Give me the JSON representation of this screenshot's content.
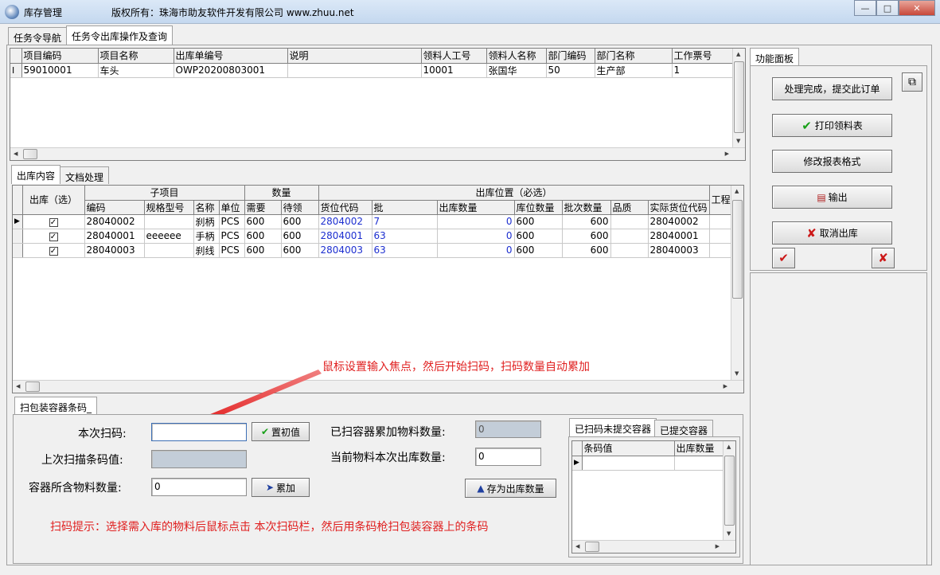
{
  "window": {
    "title": "库存管理",
    "copyright": "版权所有：珠海市助友软件开发有限公司 www.zhuu.net",
    "btn_min": "—",
    "btn_max": "□",
    "btn_close": "✕"
  },
  "top_tabs": [
    {
      "label": "任务令导航"
    },
    {
      "label": "任务令出库操作及查询"
    }
  ],
  "order_grid": {
    "row_indicator": "I",
    "columns": [
      "项目编码",
      "项目名称",
      "出库单编号",
      "说明",
      "领料人工号",
      "领料人名称",
      "部门编码",
      "部门名称",
      "工作票号"
    ],
    "rows": [
      [
        "59010001",
        "车头",
        "OWP20200803001",
        "",
        "10001",
        "张国华",
        "50",
        "生产部",
        "1"
      ]
    ]
  },
  "function_panel": {
    "tab": "功能面板",
    "submit": "处理完成，提交此订单",
    "print": "打印领料表",
    "modify_format": "修改报表格式",
    "export": "输出",
    "cancel": "取消出库"
  },
  "content_tabs": [
    {
      "label": "出库内容"
    },
    {
      "label": "文档处理"
    }
  ],
  "items_grid": {
    "group_headers": {
      "out": "出库（选）",
      "sub_item": "子项目",
      "qty": "数量",
      "location": "出库位置（必选）",
      "project": "工程"
    },
    "columns": {
      "code": "编码",
      "spec": "规格型号",
      "name": "名称",
      "unit": "单位",
      "need": "需要",
      "pending": "待领",
      "loc_code": "货位代码",
      "batch": "批",
      "out_qty": "出库数量",
      "loc_qty": "库位数量",
      "batch_qty": "批次数量",
      "quality": "品质",
      "actual_loc": "实际货位代码"
    },
    "rows": [
      {
        "checked": true,
        "code": "28040002",
        "spec": "",
        "name": "刹柄",
        "unit": "PCS",
        "need": "600",
        "pending": "600",
        "loc_code": "2804002",
        "batch": "7",
        "out_qty": "0",
        "loc_qty": "600",
        "batch_qty": "600",
        "quality": "",
        "actual_loc": "28040002"
      },
      {
        "checked": true,
        "code": "28040001",
        "spec": "eeeeee",
        "name": "手柄",
        "unit": "PCS",
        "need": "600",
        "pending": "600",
        "loc_code": "2804001",
        "batch": "63",
        "out_qty": "0",
        "loc_qty": "600",
        "batch_qty": "600",
        "quality": "",
        "actual_loc": "28040001"
      },
      {
        "checked": true,
        "code": "28040003",
        "spec": "",
        "name": "刹线",
        "unit": "PCS",
        "need": "600",
        "pending": "600",
        "loc_code": "2804003",
        "batch": "63",
        "out_qty": "0",
        "loc_qty": "600",
        "batch_qty": "600",
        "quality": "",
        "actual_loc": "28040003"
      }
    ],
    "check_mark": "✓"
  },
  "annotation": "鼠标设置输入焦点，然后开始扫码，扫码数量自动累加",
  "scan_tab": "扫包装容器条码_",
  "scan_form": {
    "current_scan_label": "本次扫码:",
    "current_scan_value": "",
    "reset_btn": "置初值",
    "last_barcode_label": "上次扫描条码值:",
    "last_barcode_value": "",
    "container_qty_label": "容器所含物料数量:",
    "container_qty_value": "0",
    "accumulate_btn": "累加",
    "scanned_total_label": "已扫容器累加物料数量:",
    "scanned_total_value": "0",
    "current_out_label": "当前物料本次出库数量:",
    "current_out_value": "0",
    "save_out_btn": "存为出库数量",
    "hint": "扫码提示：选择需入库的物料后鼠标点击 本次扫码栏，然后用条码枪扫包装容器上的条码"
  },
  "container_tabs": [
    {
      "label": "已扫码未提交容器"
    },
    {
      "label": "已提交容器"
    }
  ],
  "container_grid": {
    "columns": [
      "条码值",
      "出库数量"
    ],
    "rows": []
  },
  "colors": {
    "annotation": "#e02020",
    "hint": "#e02020",
    "location_code": "#1d2fd0",
    "ok_green": "#18a018",
    "cancel_red": "#cc1818"
  },
  "icons": [
    "app-icon",
    "copy-icon",
    "check-icon",
    "printer-icon",
    "export-icon",
    "x-icon",
    "arrow-up-icon",
    "play-icon"
  ]
}
